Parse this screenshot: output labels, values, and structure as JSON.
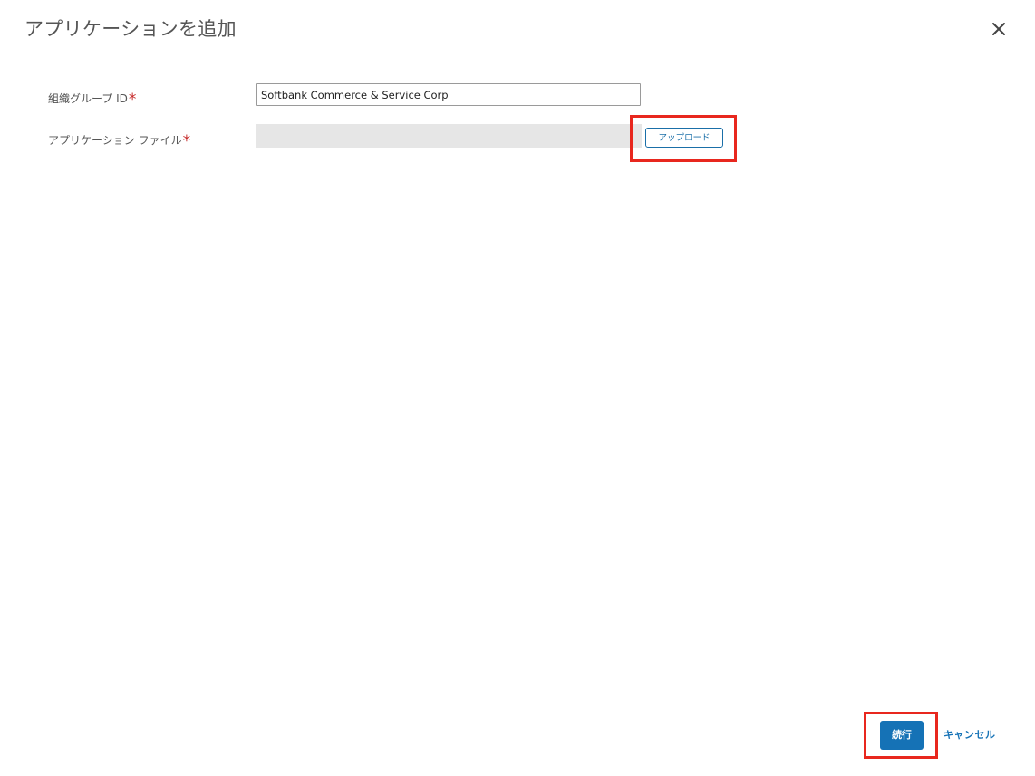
{
  "dialog": {
    "title": "アプリケーションを追加",
    "close_icon": "close-icon"
  },
  "form": {
    "org_group": {
      "label": "組織グループ ID",
      "required_mark": "*",
      "value": "Softbank Commerce & Service Corp"
    },
    "app_file": {
      "label": "アプリケーション ファイル",
      "required_mark": "*",
      "value": "",
      "upload_label": "アップロード"
    }
  },
  "footer": {
    "continue_label": "続行",
    "cancel_label": "キャンセル"
  },
  "colors": {
    "accent": "#1572b6",
    "highlight": "#e8271e",
    "required": "#c62828",
    "file_field_bg": "#e6e6e6"
  }
}
